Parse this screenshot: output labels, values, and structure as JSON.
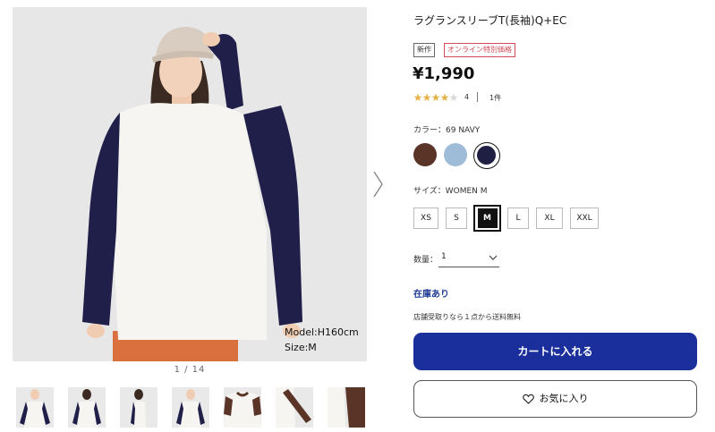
{
  "gallery": {
    "caption_model": "Model:H160cm",
    "caption_size": "Size:M",
    "page_indicator": "1 / 14",
    "next_icon": "chevron-right-icon"
  },
  "product": {
    "title": "ラグランスリーブT(長袖)Q+EC",
    "badge_new": "新作",
    "badge_online": "オンライン特別価格",
    "price": "¥1,990",
    "rating_value": "4",
    "review_count": "1件"
  },
  "color": {
    "label": "カラー：69 NAVY",
    "swatches": [
      {
        "name": "brown",
        "hex": "#5a3527"
      },
      {
        "name": "light-blue",
        "hex": "#9ebcd8"
      },
      {
        "name": "navy",
        "hex": "#1f1f44",
        "selected": true
      }
    ]
  },
  "size": {
    "label": "サイズ：WOMEN M",
    "options": [
      "XS",
      "S",
      "M",
      "L",
      "XL",
      "XXL"
    ],
    "selected": "M"
  },
  "quantity": {
    "label": "数量：",
    "value": "1"
  },
  "stock_status": "在庫あり",
  "shipping_note": "店舗受取りなら１点から送料無料",
  "cart_button": "カートに入れる",
  "favorite_button": "お気に入り",
  "colors": {
    "accent": "#1b2f9c",
    "stock_text": "#1f3a93",
    "online_badge": "#d24a5a"
  }
}
